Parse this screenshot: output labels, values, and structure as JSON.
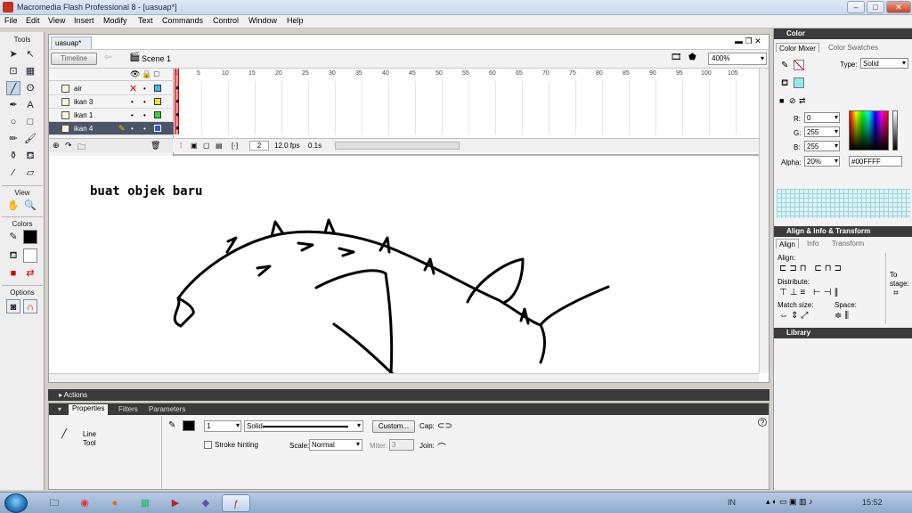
{
  "window": {
    "title": "Macromedia Flash Professional 8 - [uasuap*]",
    "controls": {
      "minimize": "–",
      "maximize": "□",
      "close": "✕"
    }
  },
  "menu": [
    "File",
    "Edit",
    "View",
    "Insert",
    "Modify",
    "Text",
    "Commands",
    "Control",
    "Window",
    "Help"
  ],
  "tools_panel": {
    "header": "Tools",
    "view_header": "View",
    "colors_header": "Colors",
    "options_header": "Options"
  },
  "document": {
    "tab": "uasuap*",
    "timeline_button": "Timeline",
    "scene": "Scene 1",
    "zoom": "400%"
  },
  "timeline": {
    "layers": [
      {
        "name": "air",
        "hidden": true,
        "color": "#2ec8d8"
      },
      {
        "name": "ikan 3",
        "hidden": false,
        "color": "#f0e030"
      },
      {
        "name": "ikan 1",
        "hidden": false,
        "color": "#40d040"
      },
      {
        "name": "ikan 4",
        "hidden": false,
        "color": "#3050e0",
        "selected": true
      }
    ],
    "frame_numbers": [
      "1",
      "5",
      "10",
      "15",
      "20",
      "25",
      "30",
      "35",
      "40",
      "45",
      "50",
      "55",
      "60",
      "65",
      "70",
      "75",
      "80",
      "85",
      "90",
      "95",
      "100",
      "105"
    ],
    "current_frame": "2",
    "fps": "12.0 fps",
    "time": "0.1s"
  },
  "stage": {
    "text": "buat objek baru"
  },
  "actions_bar": {
    "label": "Actions"
  },
  "properties": {
    "tabs": [
      "Properties",
      "Filters",
      "Parameters"
    ],
    "tool_name_line1": "Line",
    "tool_name_line2": "Tool",
    "stroke_width": "1",
    "stroke_style": "Solid",
    "custom_button": "Custom...",
    "cap_label": "Cap:",
    "stroke_hinting": "Stroke hinting",
    "scale_label": "Scale:",
    "scale_value": "Normal",
    "miter_label": "Miter:",
    "miter_value": "3",
    "join_label": "Join:",
    "help_icon": "?"
  },
  "color_panel": {
    "header": "Color",
    "tabs": [
      "Color Mixer",
      "Color Swatches"
    ],
    "type_label": "Type:",
    "type_value": "Solid",
    "r_label": "R:",
    "r_value": "0",
    "g_label": "G:",
    "g_value": "255",
    "b_label": "B:",
    "b_value": "255",
    "alpha_label": "Alpha:",
    "alpha_value": "20%",
    "hex": "#00FFFF"
  },
  "align_panel": {
    "header": "Align & Info & Transform",
    "tabs": [
      "Align",
      "Info",
      "Transform"
    ],
    "align_label": "Align:",
    "distribute_label": "Distribute:",
    "match_size_label": "Match size:",
    "space_label": "Space:",
    "to_stage_line1": "To",
    "to_stage_line2": "stage:"
  },
  "library_panel": {
    "header": "Library"
  },
  "taskbar": {
    "lang": "IN",
    "clock": "15:52"
  }
}
